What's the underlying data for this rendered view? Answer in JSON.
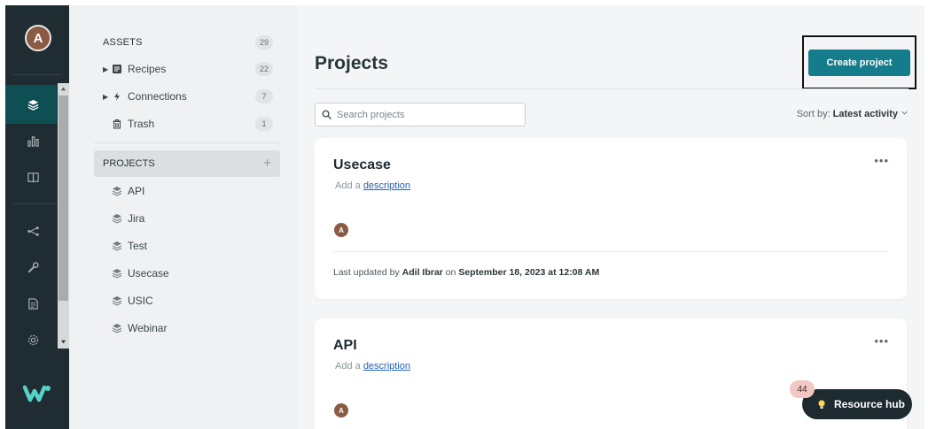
{
  "user": {
    "initial": "A"
  },
  "sidebar": {
    "assets_header": "ASSETS",
    "assets_count": "29",
    "items": [
      {
        "label": "Recipes",
        "count": "22",
        "icon": "recipe-icon"
      },
      {
        "label": "Connections",
        "count": "7",
        "icon": "connection-icon"
      },
      {
        "label": "Trash",
        "count": "1",
        "icon": "trash-icon"
      }
    ],
    "projects_header": "PROJECTS",
    "projects_add": "+",
    "projects": [
      {
        "label": "API"
      },
      {
        "label": "Jira"
      },
      {
        "label": "Test"
      },
      {
        "label": "Usecase"
      },
      {
        "label": "USIC"
      },
      {
        "label": "Webinar"
      }
    ]
  },
  "main": {
    "title": "Projects",
    "create_button": "Create project",
    "search_placeholder": "Search projects",
    "sort_prefix": "Sort by:",
    "sort_value": "Latest activity",
    "cards": [
      {
        "title": "Usecase",
        "desc_prefix": "Add a",
        "desc_link": "description",
        "avatar": "A",
        "meta_prefix": "Last updated by",
        "meta_user": "Adil Ibrar",
        "meta_on": "on",
        "meta_date": "September 18, 2023 at 12:08 AM"
      },
      {
        "title": "API",
        "desc_prefix": "Add a",
        "desc_link": "description",
        "avatar": "A"
      }
    ]
  },
  "resource_hub": {
    "label": "Resource hub",
    "badge": "44"
  },
  "colors": {
    "rail": "#1f2c32",
    "accent": "#147c8a",
    "active": "#0e4f53"
  }
}
